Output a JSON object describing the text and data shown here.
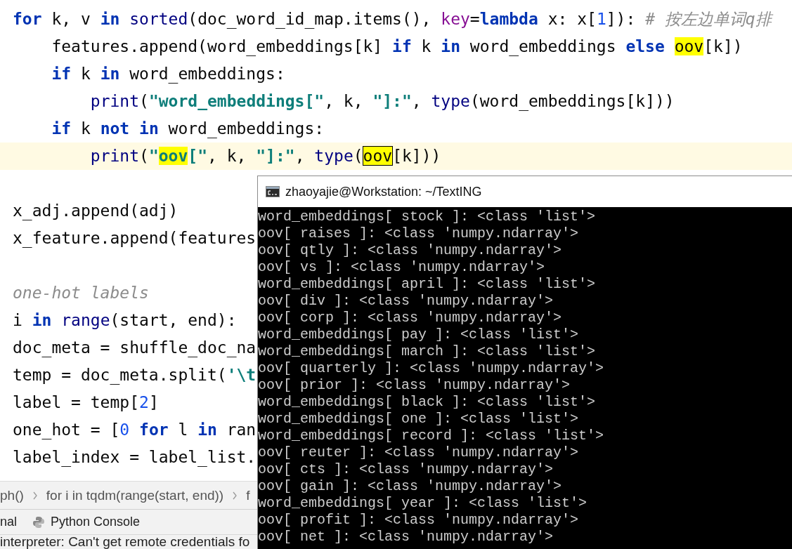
{
  "editor": {
    "lines": [
      {
        "current": false,
        "tokens": [
          {
            "kind": "kw",
            "t": "for"
          },
          {
            "kind": "p",
            "t": " k, v "
          },
          {
            "kind": "kw",
            "t": "in"
          },
          {
            "kind": "fn",
            "t": " sorted"
          },
          {
            "kind": "p",
            "t": "(doc_word_id_map.items(), "
          },
          {
            "kind": "param",
            "t": "key"
          },
          {
            "kind": "p",
            "t": "="
          },
          {
            "kind": "kw",
            "t": "lambda"
          },
          {
            "kind": "p",
            "t": " x: x["
          },
          {
            "kind": "num",
            "t": "1"
          },
          {
            "kind": "p",
            "t": "]): "
          },
          {
            "kind": "com",
            "t": "# 按左边单词q排"
          }
        ],
        "children": [
          {
            "current": false,
            "tokens": [
              {
                "kind": "p",
                "t": "features.append(word_embeddings[k] "
              },
              {
                "kind": "kw",
                "t": "if"
              },
              {
                "kind": "p",
                "t": " k "
              },
              {
                "kind": "kw",
                "t": "in"
              },
              {
                "kind": "p",
                "t": " word_embeddings "
              },
              {
                "kind": "kw",
                "t": "else "
              },
              {
                "kind": "hl",
                "t": "oov"
              },
              {
                "kind": "p",
                "t": "[k])"
              }
            ]
          },
          {
            "current": false,
            "tokens": [
              {
                "kind": "kw",
                "t": "if"
              },
              {
                "kind": "p",
                "t": " k "
              },
              {
                "kind": "kw",
                "t": "in"
              },
              {
                "kind": "p",
                "t": " word_embeddings:"
              }
            ],
            "children": [
              {
                "current": false,
                "tokens": [
                  {
                    "kind": "fn",
                    "t": "print"
                  },
                  {
                    "kind": "p",
                    "t": "("
                  },
                  {
                    "kind": "str",
                    "t": "\"word_embeddings[\""
                  },
                  {
                    "kind": "p",
                    "t": ", k, "
                  },
                  {
                    "kind": "str",
                    "t": "\"]:\""
                  },
                  {
                    "kind": "p",
                    "t": ", "
                  },
                  {
                    "kind": "fn",
                    "t": "type"
                  },
                  {
                    "kind": "p",
                    "t": "(word_embeddings[k]))"
                  }
                ]
              }
            ]
          },
          {
            "current": false,
            "tokens": [
              {
                "kind": "kw",
                "t": "if"
              },
              {
                "kind": "p",
                "t": " k "
              },
              {
                "kind": "kw",
                "t": "not in"
              },
              {
                "kind": "p",
                "t": " word_embeddings:"
              }
            ],
            "children": [
              {
                "current": true,
                "tokens": [
                  {
                    "kind": "fn",
                    "t": "print"
                  },
                  {
                    "kind": "p",
                    "t": "("
                  },
                  {
                    "kind": "str",
                    "t": "\""
                  },
                  {
                    "kind": "strhl",
                    "t": "oov"
                  },
                  {
                    "kind": "str",
                    "t": "[\""
                  },
                  {
                    "kind": "p",
                    "t": ", k, "
                  },
                  {
                    "kind": "str",
                    "t": "\"]:\""
                  },
                  {
                    "kind": "p",
                    "t": ", "
                  },
                  {
                    "kind": "fn",
                    "t": "type"
                  },
                  {
                    "kind": "p",
                    "t": "("
                  },
                  {
                    "kind": "hlbox",
                    "t": "oov"
                  },
                  {
                    "kind": "p",
                    "t": "[k]))"
                  }
                ]
              }
            ]
          }
        ]
      },
      {
        "blank": true
      },
      {
        "current": false,
        "tokens": [
          {
            "kind": "p",
            "t": "x_adj.append(adj)"
          }
        ]
      },
      {
        "current": false,
        "tokens": [
          {
            "kind": "p",
            "t": "x_feature.append(features"
          }
        ]
      },
      {
        "blank": true
      },
      {
        "current": false,
        "tokens": [
          {
            "kind": "com",
            "t": "one-hot labels"
          }
        ]
      },
      {
        "current": false,
        "tokens": [
          {
            "kind": "p",
            "t": "i "
          },
          {
            "kind": "kw",
            "t": "in"
          },
          {
            "kind": "fn",
            "t": " range"
          },
          {
            "kind": "p",
            "t": "(start, end):"
          }
        ]
      },
      {
        "current": false,
        "tokens": [
          {
            "kind": "p",
            "t": "doc_meta = shuffle_doc_na"
          }
        ]
      },
      {
        "current": false,
        "tokens": [
          {
            "kind": "p",
            "t": "temp = doc_meta.split("
          },
          {
            "kind": "str",
            "t": "'\\t"
          }
        ]
      },
      {
        "current": false,
        "tokens": [
          {
            "kind": "p",
            "t": "label = temp["
          },
          {
            "kind": "num",
            "t": "2"
          },
          {
            "kind": "p",
            "t": "]"
          }
        ]
      },
      {
        "current": false,
        "tokens": [
          {
            "kind": "p",
            "t": "one_hot = ["
          },
          {
            "kind": "num",
            "t": "0"
          },
          {
            "kind": "kw",
            "t": " for"
          },
          {
            "kind": "p",
            "t": " l "
          },
          {
            "kind": "kw",
            "t": "in"
          },
          {
            "kind": "p",
            "t": " ran"
          }
        ]
      },
      {
        "current": false,
        "tokens": [
          {
            "kind": "p",
            "t": "label_index = label_list."
          }
        ]
      }
    ]
  },
  "breadcrumbs": [
    "ph()",
    "for i in tqdm(range(start, end))",
    "f"
  ],
  "tool_tabs": [
    {
      "label": "nal",
      "kind": "text"
    },
    {
      "label": "Python Console",
      "kind": "console"
    }
  ],
  "status_bar": "interpreter: Can't get remote credentials fo",
  "terminal": {
    "title": "zhaoyajie@Workstation: ~/TextING",
    "lines": [
      "word_embeddings[ stock ]: <class 'list'>",
      "oov[ raises ]: <class 'numpy.ndarray'>",
      "oov[ qtly ]: <class 'numpy.ndarray'>",
      "oov[ vs ]: <class 'numpy.ndarray'>",
      "word_embeddings[ april ]: <class 'list'>",
      "oov[ div ]: <class 'numpy.ndarray'>",
      "oov[ corp ]: <class 'numpy.ndarray'>",
      "word_embeddings[ pay ]: <class 'list'>",
      "word_embeddings[ march ]: <class 'list'>",
      "oov[ quarterly ]: <class 'numpy.ndarray'>",
      "oov[ prior ]: <class 'numpy.ndarray'>",
      "word_embeddings[ black ]: <class 'list'>",
      "word_embeddings[ one ]: <class 'list'>",
      "word_embeddings[ record ]: <class 'list'>",
      "oov[ reuter ]: <class 'numpy.ndarray'>",
      "oov[ cts ]: <class 'numpy.ndarray'>",
      "oov[ gain ]: <class 'numpy.ndarray'>",
      "word_embeddings[ year ]: <class 'list'>",
      "oov[ profit ]: <class 'numpy.ndarray'>",
      "oov[ net ]: <class 'numpy.ndarray'>"
    ]
  }
}
